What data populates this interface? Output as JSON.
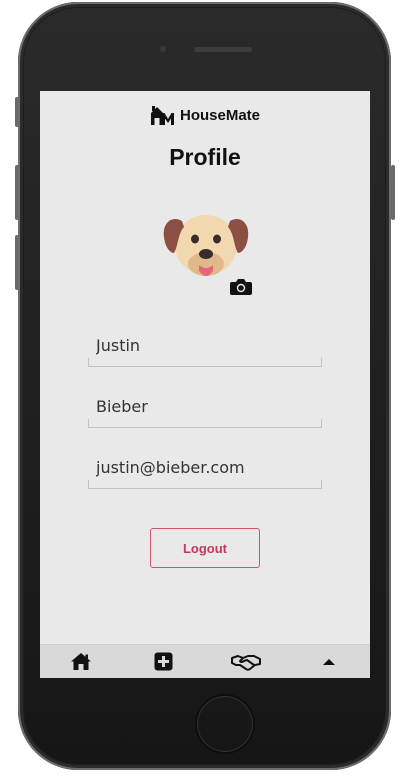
{
  "app": {
    "name": "HouseMate"
  },
  "page": {
    "title": "Profile"
  },
  "profile": {
    "first_name": "Justin",
    "last_name": "Bieber",
    "email": "justin@bieber.com",
    "avatar_icon": "dog-avatar",
    "change_photo_icon": "camera-icon"
  },
  "actions": {
    "logout_label": "Logout"
  },
  "tabbar": {
    "items": [
      {
        "icon": "home-icon"
      },
      {
        "icon": "plus-square-icon"
      },
      {
        "icon": "handshake-icon"
      },
      {
        "icon": "caret-up-icon"
      }
    ]
  },
  "colors": {
    "accent": "#c8375c",
    "screen_bg": "#e9e9e9",
    "tabbar_bg": "#d9d9d9"
  }
}
